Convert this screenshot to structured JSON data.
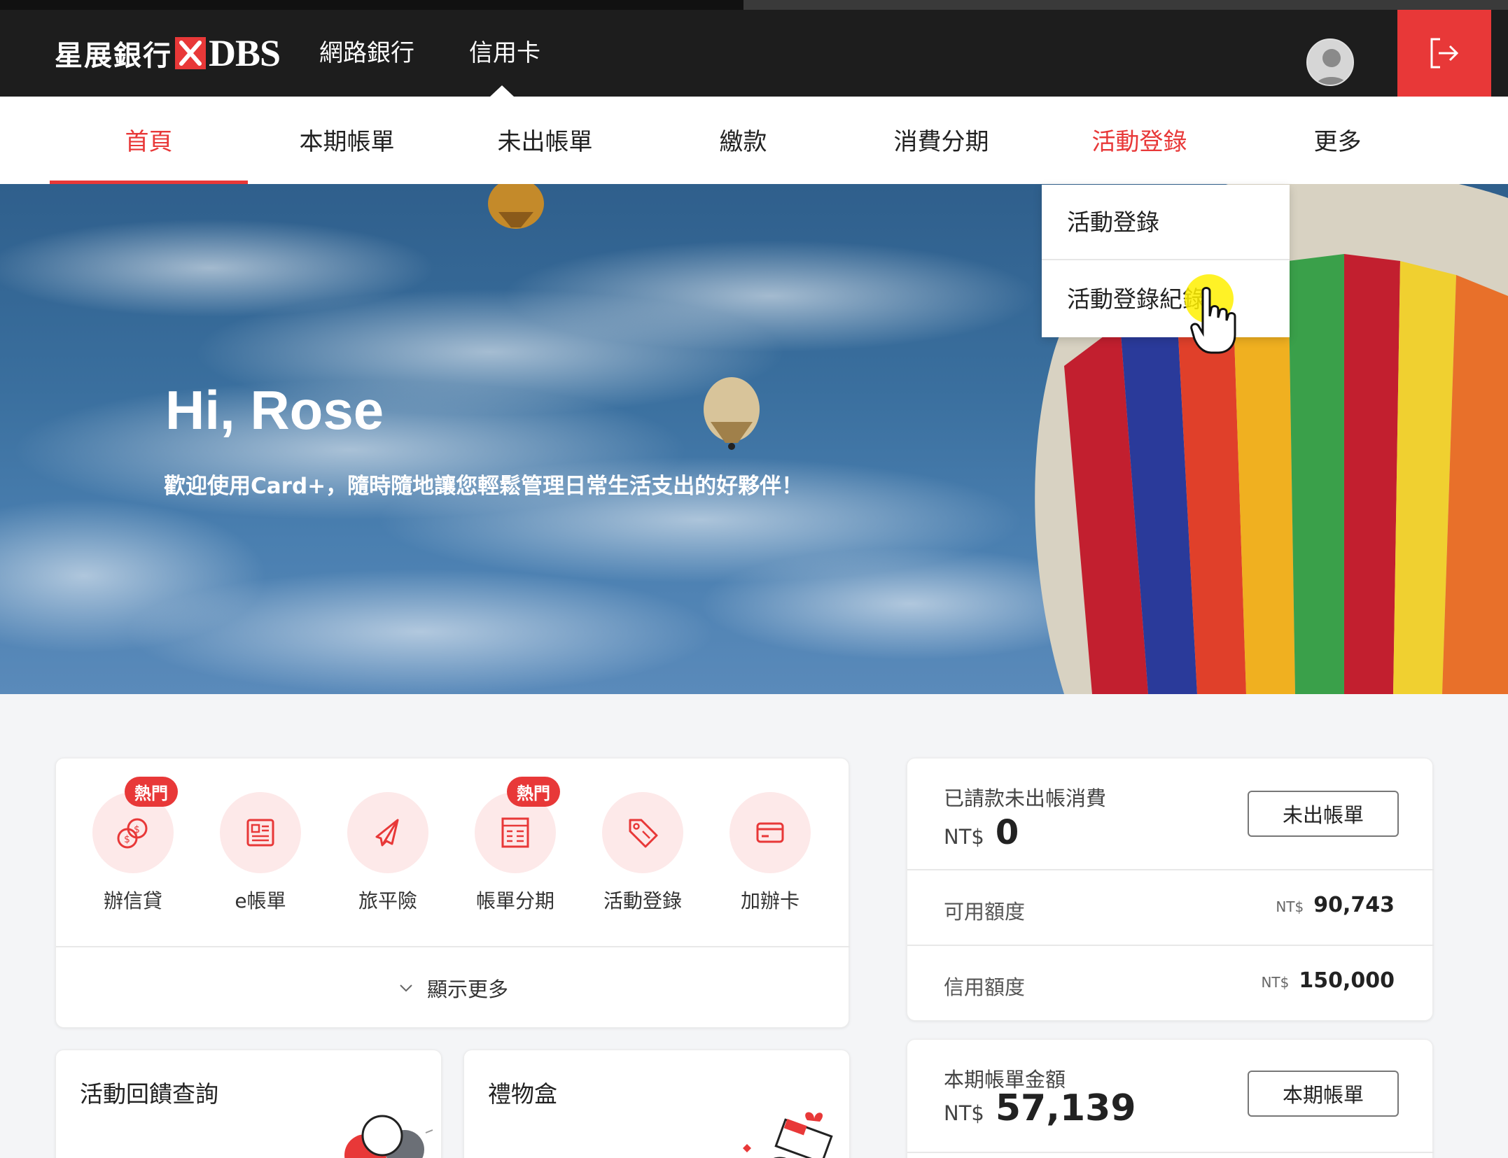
{
  "header": {
    "logo_zh": "星展銀行",
    "logo_en": "DBS",
    "nav": [
      "網路銀行",
      "信用卡"
    ]
  },
  "subnav": {
    "items": [
      "首頁",
      "本期帳單",
      "未出帳單",
      "繳款",
      "消費分期",
      "活動登錄",
      "更多"
    ]
  },
  "dropdown": {
    "items": [
      "活動登錄",
      "活動登錄紀錄"
    ]
  },
  "hero": {
    "title": "Hi, Rose",
    "subtitle": "歡迎使用Card+，隨時隨地讓您輕鬆管理日常生活支出的好夥伴！"
  },
  "quick": {
    "hot_label": "熱門",
    "items": [
      {
        "label": "辦信貸",
        "icon": "money-bag-icon"
      },
      {
        "label": "e帳單",
        "icon": "newspaper-icon"
      },
      {
        "label": "旅平險",
        "icon": "airplane-icon"
      },
      {
        "label": "帳單分期",
        "icon": "receipt-icon"
      },
      {
        "label": "活動登錄",
        "icon": "tag-icon"
      },
      {
        "label": "加辦卡",
        "icon": "credit-card-icon"
      }
    ],
    "show_more": "顯示更多"
  },
  "cards": {
    "feedback_title": "活動回饋查詢",
    "gift_title": "禮物盒"
  },
  "account": {
    "unbilled_title": "已請款未出帳消費",
    "currency": "NT$",
    "unbilled_amount": "0",
    "unbilled_button": "未出帳單",
    "available_label": "可用額度",
    "available_value": "90,743",
    "limit_label": "信用額度",
    "limit_value": "150,000"
  },
  "statement": {
    "title": "本期帳單金額",
    "currency": "NT$",
    "amount": "57,139",
    "button": "本期帳單"
  },
  "colors": {
    "brand_red": "#e83838",
    "header_bg": "#1d1d1d",
    "icon_circle": "#fde9e9"
  }
}
